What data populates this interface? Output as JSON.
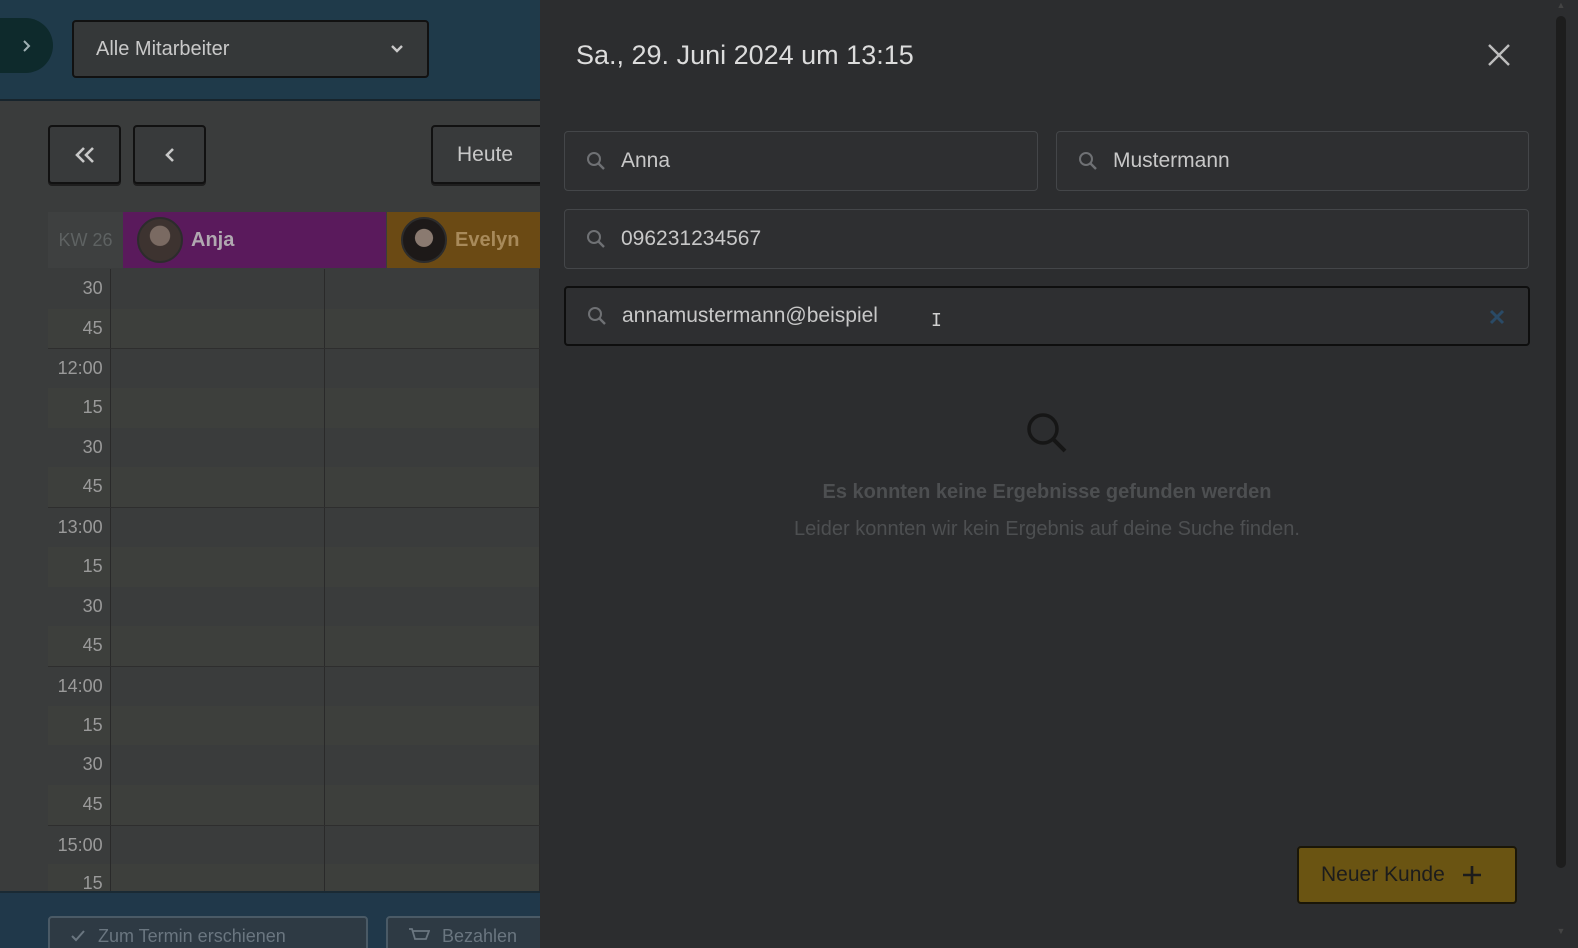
{
  "calendar": {
    "employee_filter": "Alle Mitarbeiter",
    "today_label": "Heute",
    "week_label": "KW 26",
    "employees": [
      {
        "name": "Anja",
        "color": "#8a1a8c"
      },
      {
        "name": "Evelyn",
        "color": "#c07a10"
      }
    ],
    "time_rows": [
      "30",
      "45",
      "12:00",
      "15",
      "30",
      "45",
      "13:00",
      "15",
      "30",
      "45",
      "14:00",
      "15",
      "30",
      "45",
      "15:00",
      "15"
    ],
    "footer": {
      "appear_label": "Zum Termin erschienen",
      "pay_label": "Bezahlen"
    }
  },
  "panel": {
    "title": "Sa., 29. Juni 2024 um 13:15",
    "search": {
      "first_name": "Anna",
      "last_name": "Mustermann",
      "phone": "096231234567",
      "email": "annamustermann@beispiel"
    },
    "empty_state": {
      "title": "Es konnten keine Ergebnisse gefunden werden",
      "description": "Leider konnten wir kein Ergebnis auf deine Suche finden."
    },
    "new_customer_label": "Neuer Kunde"
  },
  "colors": {
    "overlay": "#2c2d2f",
    "accent_button": "#f5c518"
  }
}
